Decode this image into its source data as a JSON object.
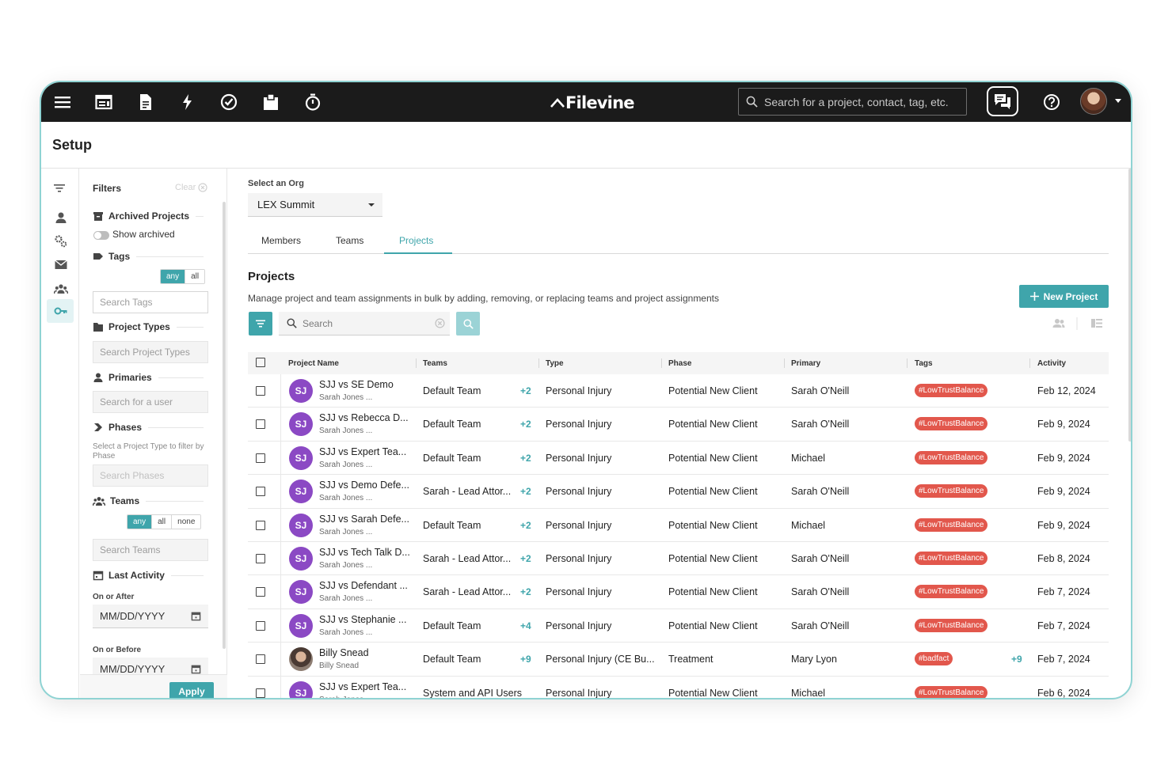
{
  "app": {
    "brand": "Filevine",
    "accent": "#3fa5ab"
  },
  "topbar": {
    "search_placeholder": "Search for a project, contact, tag, etc.",
    "icons": [
      "menu-icon",
      "board-icon",
      "document-icon",
      "lightning-icon",
      "check-circle-icon",
      "box-icon",
      "timer-icon"
    ]
  },
  "header": {
    "title": "Setup"
  },
  "filters": {
    "title": "Filters",
    "clear": "Clear",
    "archived": {
      "label": "Archived Projects",
      "toggle_label": "Show archived"
    },
    "tags": {
      "label": "Tags",
      "mode": [
        "any",
        "all"
      ],
      "placeholder": "Search Tags"
    },
    "project_types": {
      "label": "Project Types",
      "placeholder": "Search Project Types"
    },
    "primaries": {
      "label": "Primaries",
      "placeholder": "Search for a user"
    },
    "phases": {
      "label": "Phases",
      "hint": "Select a Project Type to filter by Phase",
      "placeholder": "Search Phases"
    },
    "teams": {
      "label": "Teams",
      "mode": [
        "any",
        "all",
        "none"
      ],
      "placeholder": "Search Teams"
    },
    "last_activity": {
      "label": "Last Activity",
      "after_label": "On or After",
      "after_value": "MM/DD/YYYY",
      "before_label": "On or Before",
      "before_value": "MM/DD/YYYY"
    },
    "apply": "Apply"
  },
  "main": {
    "org_label": "Select an Org",
    "org_value": "LEX Summit",
    "tabs": [
      "Members",
      "Teams",
      "Projects"
    ],
    "active_tab": "Projects",
    "title": "Projects",
    "description": "Manage project and team assignments in bulk by adding, removing, or replacing teams and project assignments",
    "new_project": "New Project",
    "search_placeholder": "Search"
  },
  "table": {
    "columns": [
      "Project Name",
      "Teams",
      "Type",
      "Phase",
      "Primary",
      "Tags",
      "Activity"
    ],
    "rows": [
      {
        "initials": "SJ",
        "name": "SJJ vs SE Demo",
        "sub": "Sarah Jones ...",
        "team": "Default Team",
        "team_more": "+2",
        "type": "Personal Injury",
        "phase": "Potential New Client",
        "primary": "Sarah O'Neill",
        "tag": "#LowTrustBalance",
        "tag_more": "",
        "activity": "Feb 12, 2024"
      },
      {
        "initials": "SJ",
        "name": "SJJ vs Rebecca D...",
        "sub": "Sarah Jones ...",
        "team": "Default Team",
        "team_more": "+2",
        "type": "Personal Injury",
        "phase": "Potential New Client",
        "primary": "Sarah O'Neill",
        "tag": "#LowTrustBalance",
        "tag_more": "",
        "activity": "Feb 9, 2024"
      },
      {
        "initials": "SJ",
        "name": "SJJ vs Expert Tea...",
        "sub": "Sarah Jones ...",
        "team": "Default Team",
        "team_more": "+2",
        "type": "Personal Injury",
        "phase": "Potential New Client",
        "primary": "Michael",
        "tag": "#LowTrustBalance",
        "tag_more": "",
        "activity": "Feb 9, 2024"
      },
      {
        "initials": "SJ",
        "name": "SJJ vs Demo Defe...",
        "sub": "Sarah Jones ...",
        "team": "Sarah - Lead Attor...",
        "team_more": "+2",
        "type": "Personal Injury",
        "phase": "Potential New Client",
        "primary": "Sarah O'Neill",
        "tag": "#LowTrustBalance",
        "tag_more": "",
        "activity": "Feb 9, 2024"
      },
      {
        "initials": "SJ",
        "name": "SJJ vs Sarah Defe...",
        "sub": "Sarah Jones ...",
        "team": "Default Team",
        "team_more": "+2",
        "type": "Personal Injury",
        "phase": "Potential New Client",
        "primary": "Michael",
        "tag": "#LowTrustBalance",
        "tag_more": "",
        "activity": "Feb 9, 2024"
      },
      {
        "initials": "SJ",
        "name": "SJJ vs Tech Talk D...",
        "sub": "Sarah Jones ...",
        "team": "Sarah - Lead Attor...",
        "team_more": "+2",
        "type": "Personal Injury",
        "phase": "Potential New Client",
        "primary": "Sarah O'Neill",
        "tag": "#LowTrustBalance",
        "tag_more": "",
        "activity": "Feb 8, 2024"
      },
      {
        "initials": "SJ",
        "name": "SJJ vs Defendant ...",
        "sub": "Sarah Jones ...",
        "team": "Sarah - Lead Attor...",
        "team_more": "+2",
        "type": "Personal Injury",
        "phase": "Potential New Client",
        "primary": "Sarah O'Neill",
        "tag": "#LowTrustBalance",
        "tag_more": "",
        "activity": "Feb 7, 2024"
      },
      {
        "initials": "SJ",
        "name": "SJJ vs Stephanie ...",
        "sub": "Sarah Jones ...",
        "team": "Default Team",
        "team_more": "+4",
        "type": "Personal Injury",
        "phase": "Potential New Client",
        "primary": "Sarah O'Neill",
        "tag": "#LowTrustBalance",
        "tag_more": "",
        "activity": "Feb 7, 2024"
      },
      {
        "initials": "",
        "name": "Billy Snead",
        "sub": "Billy Snead",
        "team": "Default Team",
        "team_more": "+9",
        "type": "Personal Injury (CE Bu...",
        "phase": "Treatment",
        "primary": "Mary Lyon",
        "tag": "#badfact",
        "tag_more": "+9",
        "activity": "Feb 7, 2024"
      },
      {
        "initials": "SJ",
        "name": "SJJ vs Expert Tea...",
        "sub": "Sarah Jones",
        "team": "System and API Users",
        "team_more": "",
        "type": "Personal Injury",
        "phase": "Potential New Client",
        "primary": "Michael",
        "tag": "#LowTrustBalance",
        "tag_more": "",
        "activity": "Feb 6, 2024"
      }
    ]
  }
}
